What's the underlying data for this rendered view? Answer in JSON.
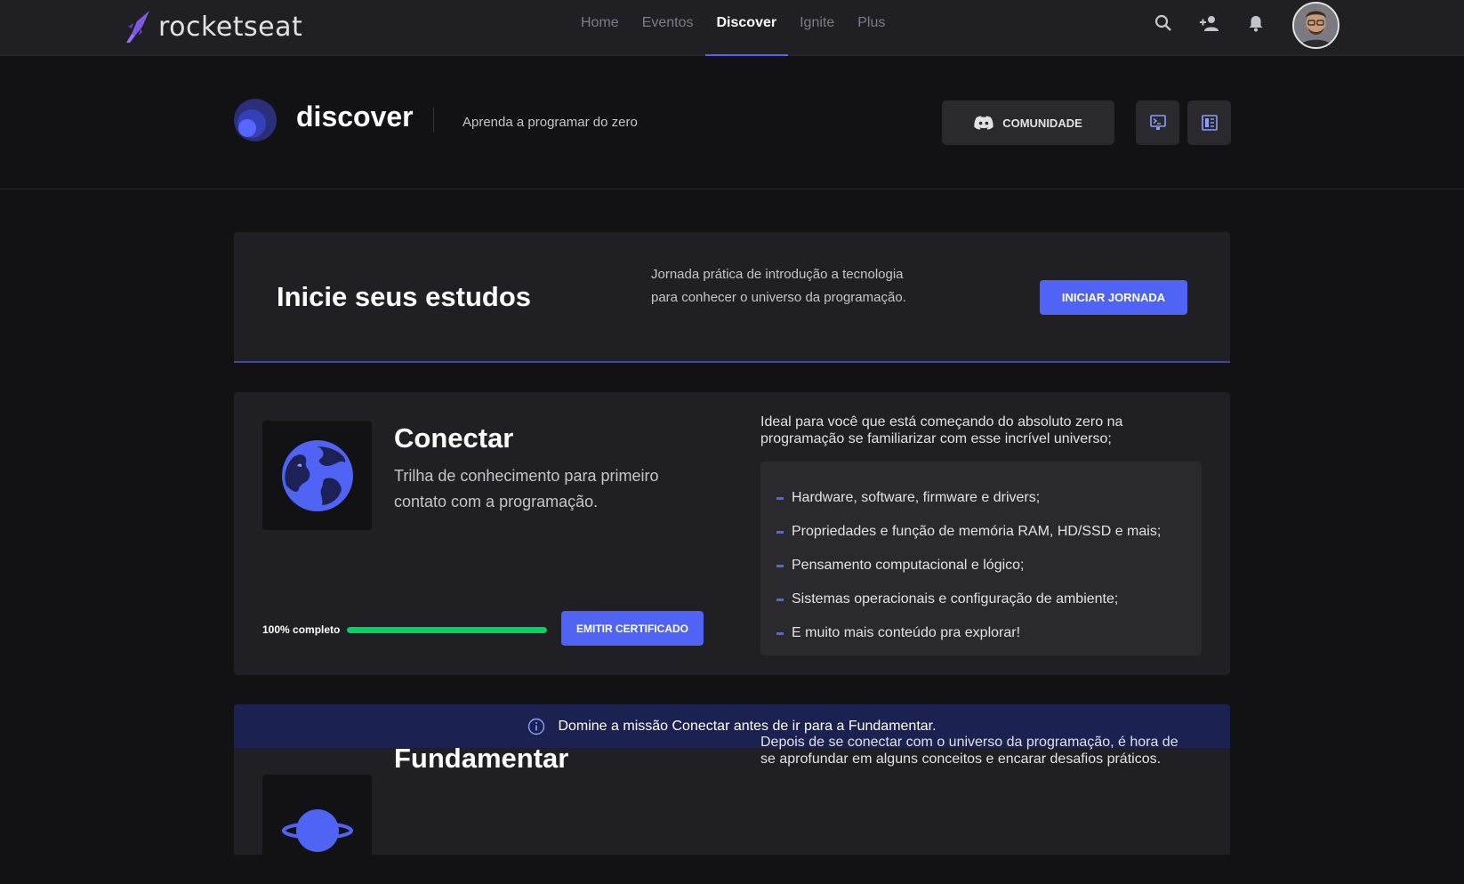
{
  "brand": {
    "name": "rocketseat"
  },
  "nav": {
    "items": [
      {
        "label": "Home",
        "active": false
      },
      {
        "label": "Eventos",
        "active": false
      },
      {
        "label": "Discover",
        "active": true
      },
      {
        "label": "Ignite",
        "active": false
      },
      {
        "label": "Plus",
        "active": false
      }
    ],
    "icons": [
      "search-icon",
      "add-person-icon",
      "bell-icon"
    ]
  },
  "discover": {
    "title": "discover",
    "subtitle": "Aprenda a programar do zero",
    "community_button": "COMUNIDADE"
  },
  "start": {
    "title": "Inicie seus estudos",
    "description": "Jornada prática de introdução a tecnologia para conhecer o universo da programação.",
    "button": "INICIAR JORNADA"
  },
  "track1": {
    "title": "Conectar",
    "description": "Trilha de conhecimento para primeiro contato com a programação.",
    "progress_label": "100% completo",
    "progress": 1.0,
    "certificate_button": "EMITIR CERTIFICADO",
    "intro": "Ideal para você que está começando do absoluto zero na programação se familiarizar com esse incrível universo;",
    "topics": [
      "Hardware, software, firmware e drivers;",
      "Propriedades e função de memória RAM, HD/SSD e mais;",
      "Pensamento computacional e lógico;",
      "Sistemas operacionais e configuração de ambiente;",
      "E muito mais conteúdo pra explorar!"
    ]
  },
  "info": {
    "message": "Domine a missão Conectar antes de ir para a Fundamentar."
  },
  "track2": {
    "title": "Fundamentar",
    "intro": "Depois de se conectar com o universo da programação, é hora de se aprofundar em alguns conceitos e encarar desafios práticos."
  },
  "colors": {
    "accent": "#4f63f5",
    "success": "#04d361",
    "background": "#121214",
    "surface": "#202024"
  }
}
